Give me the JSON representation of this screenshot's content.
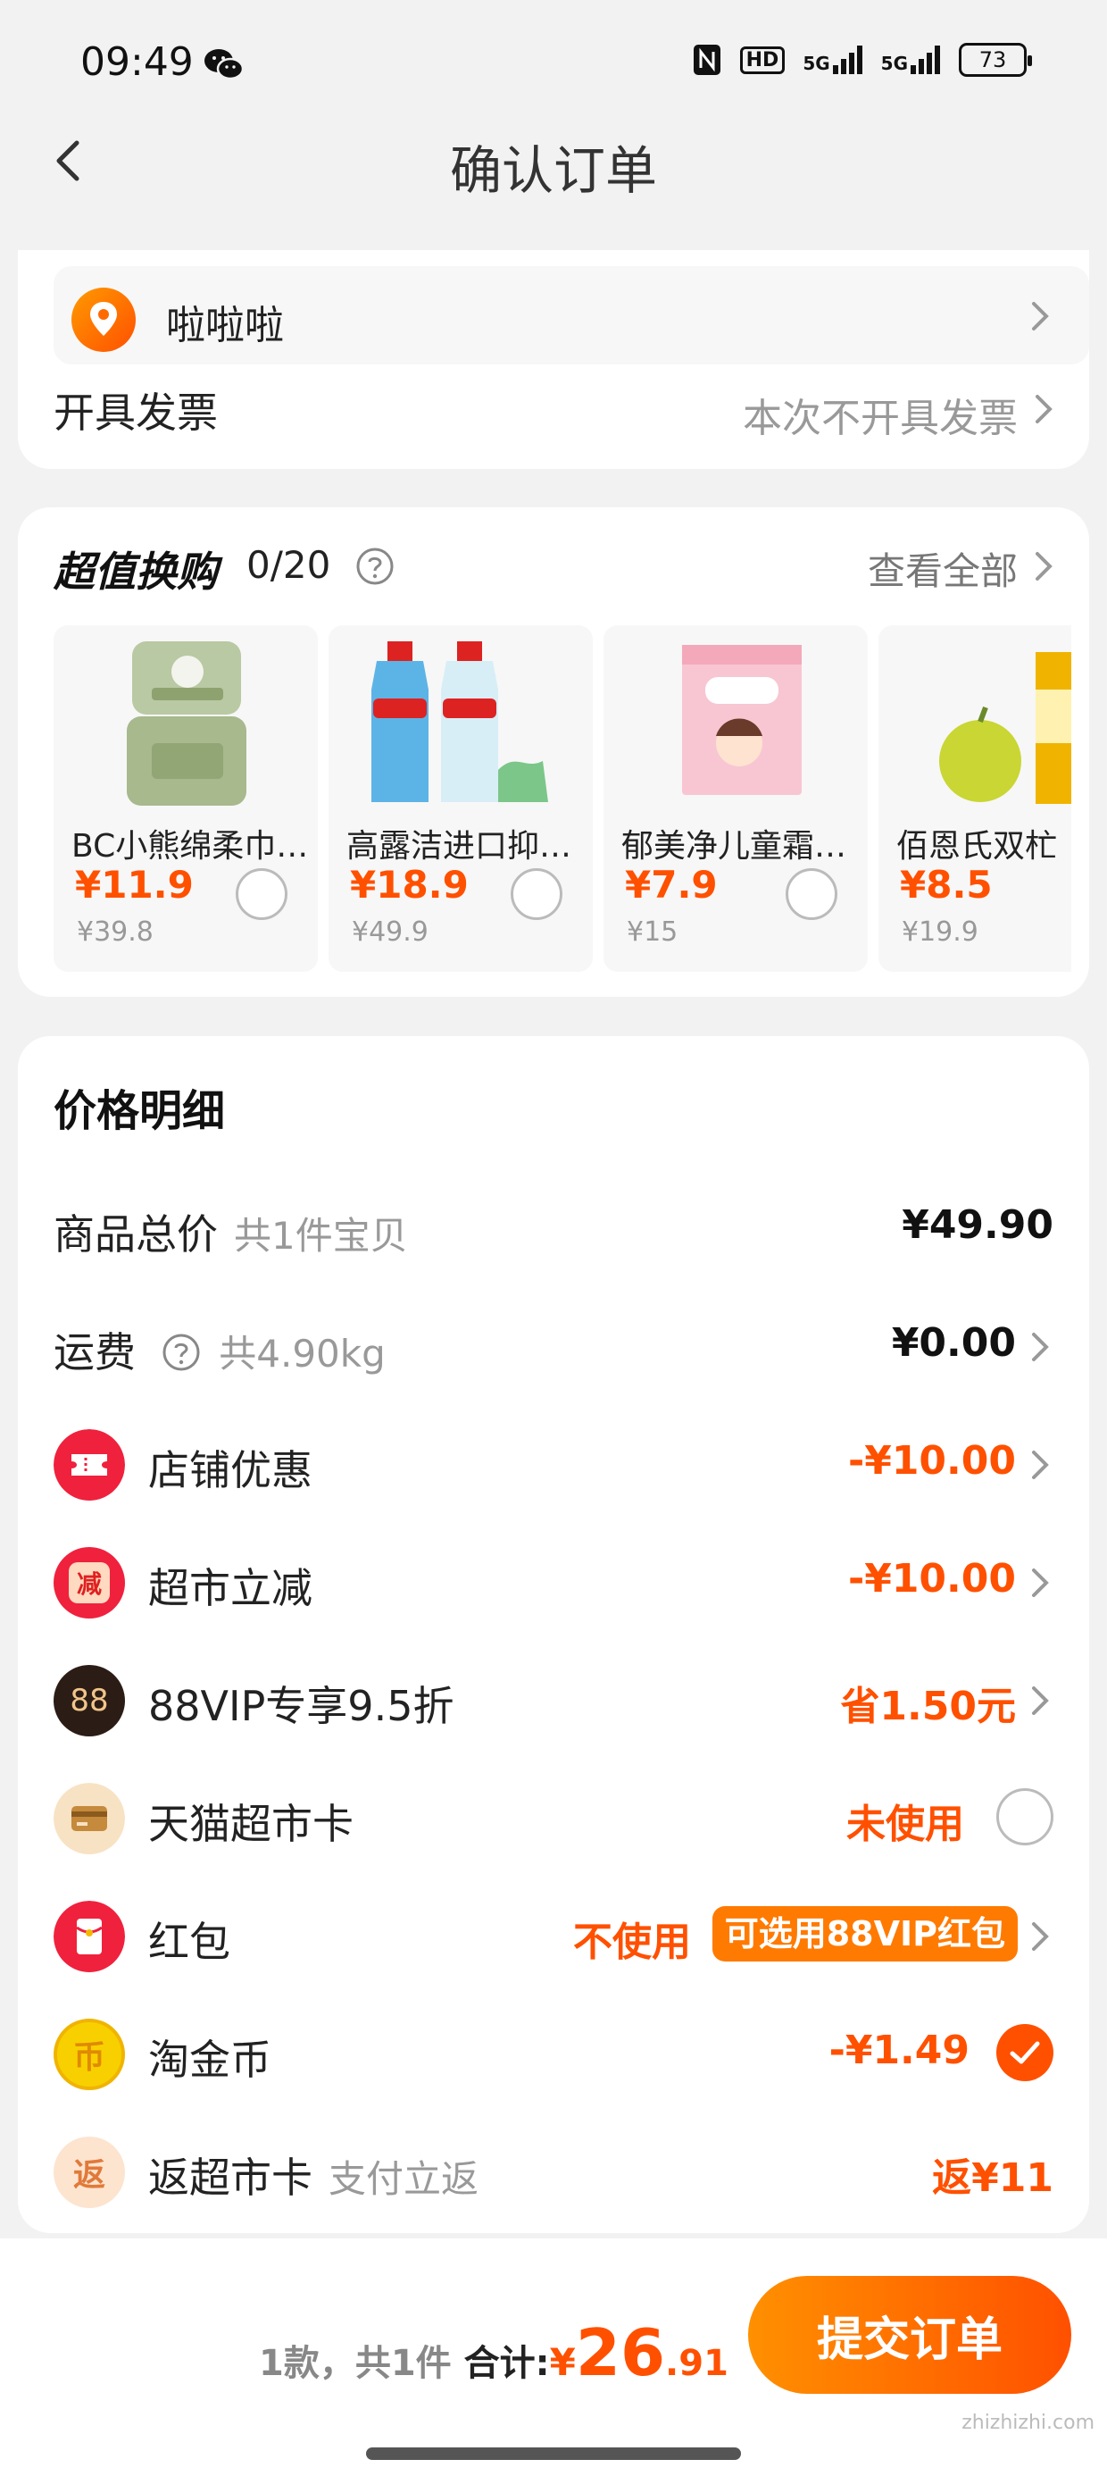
{
  "status_bar": {
    "time": "09:49",
    "signal_1": "5G",
    "signal_2": "5G",
    "hd": "HD",
    "battery": "73"
  },
  "nav": {
    "title": "确认订单"
  },
  "address": {
    "name": "啦啦啦"
  },
  "invoice": {
    "label": "开具发票",
    "value": "本次不开具发票"
  },
  "deals": {
    "title": "超值换购",
    "count": "0/20",
    "view_all": "查看全部",
    "items": [
      {
        "name": "BC小熊绵柔巾…",
        "price": "¥11.9",
        "original": "¥39.8"
      },
      {
        "name": "高露洁进口抑…",
        "price": "¥18.9",
        "original": "¥49.9"
      },
      {
        "name": "郁美净儿童霜…",
        "price": "¥7.9",
        "original": "¥15"
      },
      {
        "name": "佰恩氏双杧",
        "price": "¥8.5",
        "original": "¥19.9"
      }
    ]
  },
  "price_detail": {
    "title": "价格明细",
    "goods_total": {
      "label": "商品总价",
      "sub": "共1件宝贝",
      "value": "¥49.90"
    },
    "shipping": {
      "label": "运费",
      "sub": "共4.90kg",
      "value": "¥0.00"
    },
    "store_discount": {
      "label": "店铺优惠",
      "value": "-¥10.00"
    },
    "market_reduction": {
      "label": "超市立减",
      "value": "-¥10.00",
      "icon_text": "减"
    },
    "vip": {
      "label": "88VIP专享9.5折",
      "value": "省1.50元",
      "icon_text": "88"
    },
    "market_card": {
      "label": "天猫超市卡",
      "value": "未使用"
    },
    "red_packet": {
      "label": "红包",
      "value": "不使用",
      "badge": "可选用88VIP红包"
    },
    "gold_coin": {
      "label": "淘金币",
      "value": "-¥1.49",
      "icon_text": "币"
    },
    "cashback": {
      "label": "返超市卡",
      "sub": "支付立返",
      "value": "返¥11",
      "icon_text": "返"
    }
  },
  "bottom": {
    "summary": "1款，共1件",
    "total_label": "合计:",
    "currency": "¥",
    "total_int": "26",
    "total_dec": ".91",
    "submit": "提交订单"
  },
  "watermark": "zhizhizhi.com",
  "colors": {
    "accent": "#ff5000",
    "accent_light": "#ff9000",
    "background": "#f2f2f2"
  }
}
